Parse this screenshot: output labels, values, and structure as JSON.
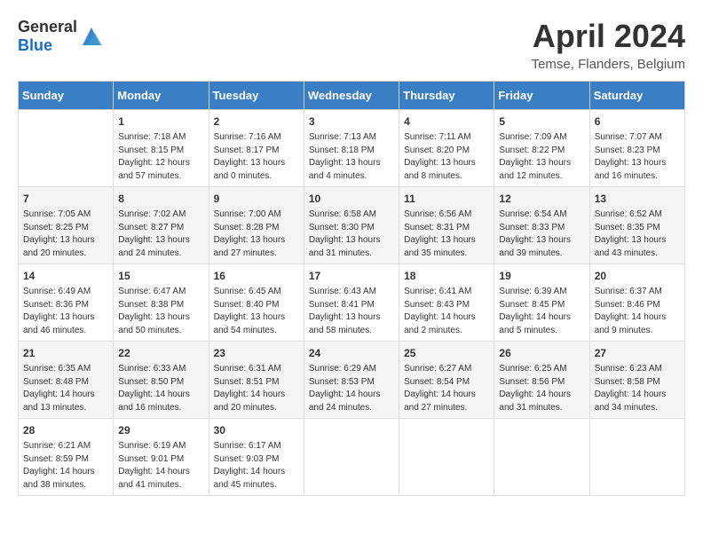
{
  "header": {
    "logo_general": "General",
    "logo_blue": "Blue",
    "month_title": "April 2024",
    "location": "Temse, Flanders, Belgium"
  },
  "weekdays": [
    "Sunday",
    "Monday",
    "Tuesday",
    "Wednesday",
    "Thursday",
    "Friday",
    "Saturday"
  ],
  "weeks": [
    [
      {
        "day": "",
        "content": ""
      },
      {
        "day": "1",
        "content": "Sunrise: 7:18 AM\nSunset: 8:15 PM\nDaylight: 12 hours\nand 57 minutes."
      },
      {
        "day": "2",
        "content": "Sunrise: 7:16 AM\nSunset: 8:17 PM\nDaylight: 13 hours\nand 0 minutes."
      },
      {
        "day": "3",
        "content": "Sunrise: 7:13 AM\nSunset: 8:18 PM\nDaylight: 13 hours\nand 4 minutes."
      },
      {
        "day": "4",
        "content": "Sunrise: 7:11 AM\nSunset: 8:20 PM\nDaylight: 13 hours\nand 8 minutes."
      },
      {
        "day": "5",
        "content": "Sunrise: 7:09 AM\nSunset: 8:22 PM\nDaylight: 13 hours\nand 12 minutes."
      },
      {
        "day": "6",
        "content": "Sunrise: 7:07 AM\nSunset: 8:23 PM\nDaylight: 13 hours\nand 16 minutes."
      }
    ],
    [
      {
        "day": "7",
        "content": "Sunrise: 7:05 AM\nSunset: 8:25 PM\nDaylight: 13 hours\nand 20 minutes."
      },
      {
        "day": "8",
        "content": "Sunrise: 7:02 AM\nSunset: 8:27 PM\nDaylight: 13 hours\nand 24 minutes."
      },
      {
        "day": "9",
        "content": "Sunrise: 7:00 AM\nSunset: 8:28 PM\nDaylight: 13 hours\nand 27 minutes."
      },
      {
        "day": "10",
        "content": "Sunrise: 6:58 AM\nSunset: 8:30 PM\nDaylight: 13 hours\nand 31 minutes."
      },
      {
        "day": "11",
        "content": "Sunrise: 6:56 AM\nSunset: 8:31 PM\nDaylight: 13 hours\nand 35 minutes."
      },
      {
        "day": "12",
        "content": "Sunrise: 6:54 AM\nSunset: 8:33 PM\nDaylight: 13 hours\nand 39 minutes."
      },
      {
        "day": "13",
        "content": "Sunrise: 6:52 AM\nSunset: 8:35 PM\nDaylight: 13 hours\nand 43 minutes."
      }
    ],
    [
      {
        "day": "14",
        "content": "Sunrise: 6:49 AM\nSunset: 8:36 PM\nDaylight: 13 hours\nand 46 minutes."
      },
      {
        "day": "15",
        "content": "Sunrise: 6:47 AM\nSunset: 8:38 PM\nDaylight: 13 hours\nand 50 minutes."
      },
      {
        "day": "16",
        "content": "Sunrise: 6:45 AM\nSunset: 8:40 PM\nDaylight: 13 hours\nand 54 minutes."
      },
      {
        "day": "17",
        "content": "Sunrise: 6:43 AM\nSunset: 8:41 PM\nDaylight: 13 hours\nand 58 minutes."
      },
      {
        "day": "18",
        "content": "Sunrise: 6:41 AM\nSunset: 8:43 PM\nDaylight: 14 hours\nand 2 minutes."
      },
      {
        "day": "19",
        "content": "Sunrise: 6:39 AM\nSunset: 8:45 PM\nDaylight: 14 hours\nand 5 minutes."
      },
      {
        "day": "20",
        "content": "Sunrise: 6:37 AM\nSunset: 8:46 PM\nDaylight: 14 hours\nand 9 minutes."
      }
    ],
    [
      {
        "day": "21",
        "content": "Sunrise: 6:35 AM\nSunset: 8:48 PM\nDaylight: 14 hours\nand 13 minutes."
      },
      {
        "day": "22",
        "content": "Sunrise: 6:33 AM\nSunset: 8:50 PM\nDaylight: 14 hours\nand 16 minutes."
      },
      {
        "day": "23",
        "content": "Sunrise: 6:31 AM\nSunset: 8:51 PM\nDaylight: 14 hours\nand 20 minutes."
      },
      {
        "day": "24",
        "content": "Sunrise: 6:29 AM\nSunset: 8:53 PM\nDaylight: 14 hours\nand 24 minutes."
      },
      {
        "day": "25",
        "content": "Sunrise: 6:27 AM\nSunset: 8:54 PM\nDaylight: 14 hours\nand 27 minutes."
      },
      {
        "day": "26",
        "content": "Sunrise: 6:25 AM\nSunset: 8:56 PM\nDaylight: 14 hours\nand 31 minutes."
      },
      {
        "day": "27",
        "content": "Sunrise: 6:23 AM\nSunset: 8:58 PM\nDaylight: 14 hours\nand 34 minutes."
      }
    ],
    [
      {
        "day": "28",
        "content": "Sunrise: 6:21 AM\nSunset: 8:59 PM\nDaylight: 14 hours\nand 38 minutes."
      },
      {
        "day": "29",
        "content": "Sunrise: 6:19 AM\nSunset: 9:01 PM\nDaylight: 14 hours\nand 41 minutes."
      },
      {
        "day": "30",
        "content": "Sunrise: 6:17 AM\nSunset: 9:03 PM\nDaylight: 14 hours\nand 45 minutes."
      },
      {
        "day": "",
        "content": ""
      },
      {
        "day": "",
        "content": ""
      },
      {
        "day": "",
        "content": ""
      },
      {
        "day": "",
        "content": ""
      }
    ]
  ]
}
